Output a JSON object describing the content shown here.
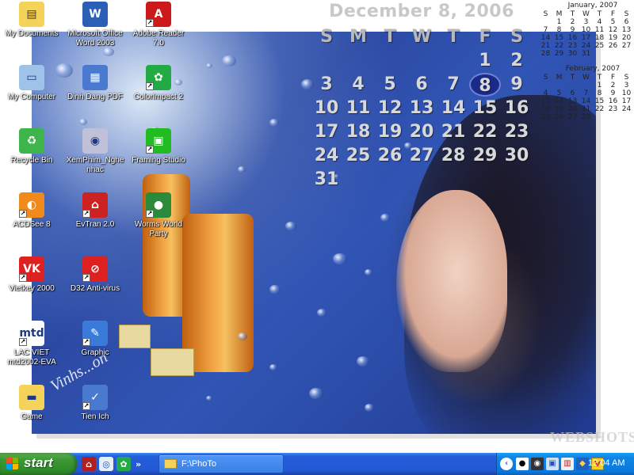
{
  "calendar_main": {
    "title": "December 8, 2006",
    "weekdays": [
      "S",
      "M",
      "T",
      "W",
      "T",
      "F",
      "S"
    ],
    "days": [
      "",
      "",
      "",
      "",
      "",
      "1",
      "2",
      "3",
      "4",
      "5",
      "6",
      "7",
      "8",
      "9",
      "10",
      "11",
      "12",
      "13",
      "14",
      "15",
      "16",
      "17",
      "18",
      "19",
      "20",
      "21",
      "22",
      "23",
      "24",
      "25",
      "26",
      "27",
      "28",
      "29",
      "30",
      "31",
      "",
      "",
      "",
      "",
      "",
      ""
    ],
    "today": "8"
  },
  "calendar_next": {
    "title": "January, 2007",
    "weekdays": [
      "S",
      "M",
      "T",
      "W",
      "T",
      "F",
      "S"
    ],
    "days": [
      "",
      "1",
      "2",
      "3",
      "4",
      "5",
      "6",
      "7",
      "8",
      "9",
      "10",
      "11",
      "12",
      "13",
      "14",
      "15",
      "16",
      "17",
      "18",
      "19",
      "20",
      "21",
      "22",
      "23",
      "24",
      "25",
      "26",
      "27",
      "28",
      "29",
      "30",
      "31",
      "",
      "",
      ""
    ]
  },
  "calendar_after": {
    "title": "February, 2007",
    "weekdays": [
      "S",
      "M",
      "T",
      "W",
      "T",
      "F",
      "S"
    ],
    "days": [
      "",
      "",
      "",
      "",
      "1",
      "2",
      "3",
      "4",
      "5",
      "6",
      "7",
      "8",
      "9",
      "10",
      "11",
      "12",
      "13",
      "14",
      "15",
      "16",
      "17",
      "18",
      "19",
      "20",
      "21",
      "22",
      "23",
      "24",
      "25",
      "26",
      "27",
      "28",
      "",
      "",
      ""
    ]
  },
  "desktop_icons": [
    {
      "name": "my-documents-icon",
      "label": "My Documents",
      "icon": "folder-document",
      "color": "#f5d35a"
    },
    {
      "name": "microsoft-office-word-2003-icon",
      "label": "Microsoft Office Word 2003",
      "icon": "word-w",
      "color": "#2b5fb5"
    },
    {
      "name": "adobe-reader-icon",
      "label": "Adobe Reader 7.0",
      "icon": "adobe-a",
      "color": "#cc1a1a"
    },
    {
      "name": "my-computer-icon",
      "label": "My Computer",
      "icon": "computer",
      "color": "#9fc2e8"
    },
    {
      "name": "dinh-dang-pdf-icon",
      "label": "Dinh Dang PDF",
      "icon": "window-doc",
      "color": "#4a7ad0"
    },
    {
      "name": "colorimpact-icon",
      "label": "ColorImpact 2",
      "icon": "color-wheel",
      "color": "#22aa44"
    },
    {
      "name": "recycle-bin-icon",
      "label": "Recycle Bin",
      "icon": "recycle",
      "color": "#3db54a"
    },
    {
      "name": "xemphim-nghe-nhac-icon",
      "label": "XemPhim_Nghe nhac",
      "icon": "media-disc",
      "color": "#c0c0d8"
    },
    {
      "name": "framing-studio-icon",
      "label": "Framing Studio",
      "icon": "frame",
      "color": "#22bb22"
    },
    {
      "name": "acdsee-icon",
      "label": "ACDSee 8",
      "icon": "acdsee-eye",
      "color": "#f08a1c"
    },
    {
      "name": "evtran-icon",
      "label": "EvTran 2.0",
      "icon": "temple",
      "color": "#cc2222"
    },
    {
      "name": "worms-world-party-icon",
      "label": "Worms World Party",
      "icon": "globe",
      "color": "#2a8a3a"
    },
    {
      "name": "vietkey-icon",
      "label": "Vietkey 2000",
      "icon": "vk-red",
      "color": "#dd2020"
    },
    {
      "name": "d32-antivirus-icon",
      "label": "D32 Anti-virus",
      "icon": "no-bug",
      "color": "#dd2020"
    },
    {
      "name": "lac-viet-icon",
      "label": "LAC VIET mtd2002-EVA",
      "icon": "mtd",
      "color": "#ffffff"
    },
    {
      "name": "graphic-icon",
      "label": "Graphic",
      "icon": "palette",
      "color": "#3a7ad8"
    },
    {
      "name": "game-icon",
      "label": "Game",
      "icon": "folder",
      "color": "#f5d35a"
    },
    {
      "name": "tien-ich-icon",
      "label": "Tien Ich",
      "icon": "tools",
      "color": "#4a7ad0"
    }
  ],
  "watermarks": {
    "brand": "WEBSHOTS",
    "signature": "Vinhs...on"
  },
  "taskbar": {
    "start_label": "start",
    "quick_launch": [
      "evtran",
      "disk-cleanup",
      "colorimpact"
    ],
    "chevron": "»",
    "task_button_label": "F:\\PhoTo",
    "tray_icons": [
      "panda",
      "webcam",
      "monitor",
      "chart",
      "shield",
      "vietkey-v"
    ],
    "clock": "12:04 AM"
  },
  "colors": {
    "taskbar_blue": "#245edb",
    "start_green": "#3c9a35",
    "tray_blue": "#0b78da"
  }
}
